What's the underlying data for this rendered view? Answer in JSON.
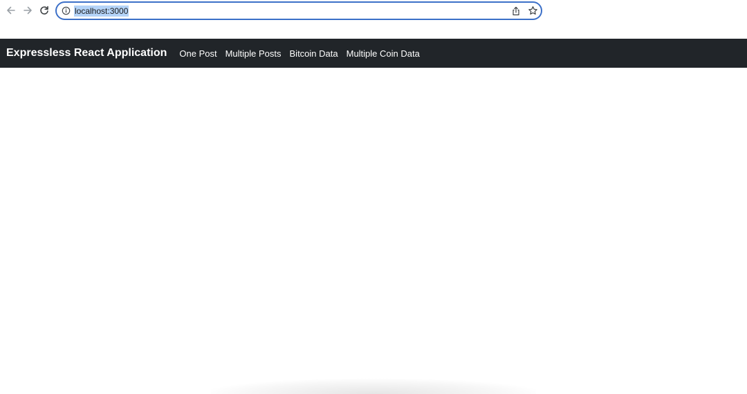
{
  "browser": {
    "url": "localhost:3000",
    "icons": {
      "back": "arrow-left-icon",
      "forward": "arrow-right-icon",
      "reload": "reload-icon",
      "site_info": "info-icon",
      "share": "share-icon",
      "bookmark": "star-icon"
    },
    "colors": {
      "focus_ring": "#3b6fc8",
      "url_selection": "#b4d3f7"
    }
  },
  "navbar": {
    "brand": "Expressless React Application",
    "links": [
      {
        "label": "One Post"
      },
      {
        "label": "Multiple Posts"
      },
      {
        "label": "Bitcoin Data"
      },
      {
        "label": "Multiple Coin Data"
      }
    ],
    "colors": {
      "background": "#212529",
      "text": "#ffffff"
    }
  }
}
